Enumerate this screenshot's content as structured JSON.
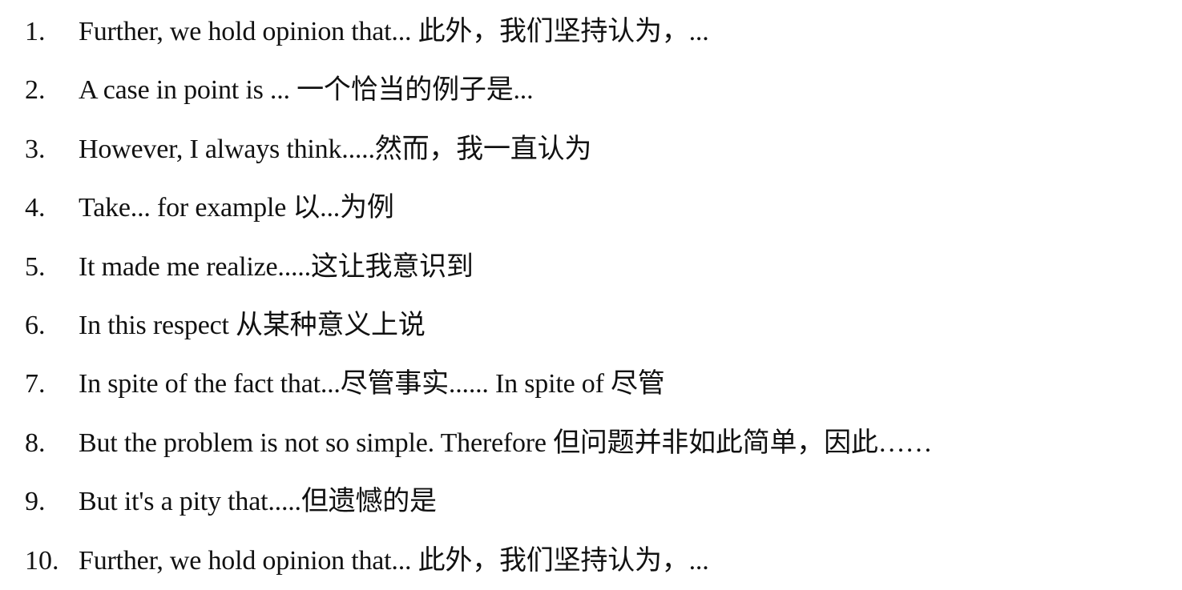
{
  "items": [
    {
      "number": "1.",
      "text": "Further, we hold opinion that...  此外，我们坚持认为，..."
    },
    {
      "number": "2.",
      "text": "A case in point is ...  一个恰当的例子是..."
    },
    {
      "number": "3.",
      "text": "However, I always think.....然而，我一直认为"
    },
    {
      "number": "4.",
      "text": "Take... for example  以...为例"
    },
    {
      "number": "5.",
      "text": "It made me realize.....这让我意识到"
    },
    {
      "number": "6.",
      "text": "In this respect 从某种意义上说"
    },
    {
      "number": "7.",
      "text": "In spite of the fact that...尽管事实...... In spite of  尽管"
    },
    {
      "number": "8.",
      "text": "But the problem is not so simple. Therefore  但问题并非如此简单，因此……"
    },
    {
      "number": "9.",
      "text": "But it's a pity that.....但遗憾的是"
    },
    {
      "number": "10.",
      "text": "Further, we hold opinion that...  此外，我们坚持认为，..."
    }
  ]
}
